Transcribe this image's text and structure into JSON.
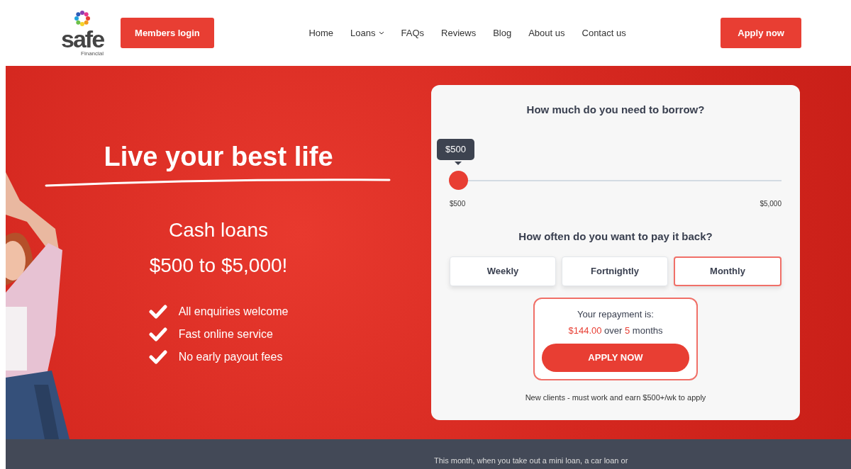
{
  "header": {
    "logo": {
      "name": "safe",
      "sub": "Financial"
    },
    "login_button": "Members login",
    "nav": [
      {
        "label": "Home",
        "dropdown": false
      },
      {
        "label": "Loans",
        "dropdown": true
      },
      {
        "label": "FAQs",
        "dropdown": false
      },
      {
        "label": "Reviews",
        "dropdown": false
      },
      {
        "label": "Blog",
        "dropdown": false
      },
      {
        "label": "About us",
        "dropdown": false
      },
      {
        "label": "Contact us",
        "dropdown": false
      }
    ],
    "apply_button": "Apply now"
  },
  "hero": {
    "headline": "Live your best life",
    "subtitle": "Cash loans",
    "range": "$500 to $5,000!",
    "features": [
      "All enquiries welcome",
      "Fast online service",
      "No early payout fees"
    ]
  },
  "calculator": {
    "borrow_question": "How much do you need to borrow?",
    "slider": {
      "level": 0,
      "tooltip": "$500",
      "min_label": "$500",
      "max_label": "$5,000"
    },
    "frequency_question": "How often do you want to pay it back?",
    "frequencies": [
      {
        "label": "Weekly",
        "selected": false
      },
      {
        "label": "Fortnightly",
        "selected": false
      },
      {
        "label": "Monthly",
        "selected": true
      }
    ],
    "repayment": {
      "label": "Your repayment is:",
      "amount": "$144.00",
      "connector": "over",
      "count": "5",
      "unit": "months"
    },
    "apply_button": "APPLY NOW",
    "note": "New clients - must work and earn $500+/wk to apply"
  },
  "promo": {
    "text": "This month, when you take out a mini loan, a car loan or"
  }
}
